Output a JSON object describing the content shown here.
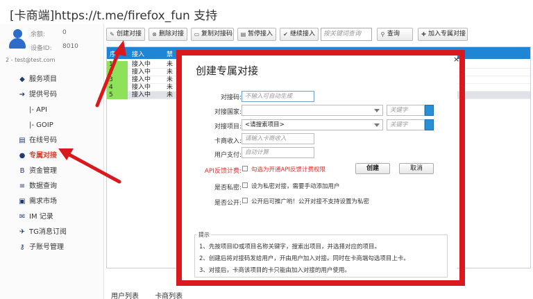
{
  "window": {
    "title": "[卡商端]https://t.me/firefox_fun 支持"
  },
  "account": {
    "balance_label": "余额:",
    "balance_value": "0",
    "id_label": "设备ID:",
    "id_value": "8010",
    "user_line": "2 - test@test.com"
  },
  "sidebar": {
    "items": [
      {
        "label": "服务项目",
        "icon": "diamond-icon",
        "glyph": "◆"
      },
      {
        "label": "提供号码",
        "icon": "arrow-icon",
        "glyph": "➔"
      },
      {
        "label": "|- API",
        "icon": "",
        "glyph": ""
      },
      {
        "label": "|- GOIP",
        "icon": "",
        "glyph": ""
      },
      {
        "label": "在线号码",
        "icon": "list-icon",
        "glyph": "▤"
      },
      {
        "label": "专属对接",
        "icon": "users-icon",
        "glyph": "●"
      },
      {
        "label": "资金管理",
        "icon": "bold-b-icon",
        "glyph": "B"
      },
      {
        "label": "数据查询",
        "icon": "bars-icon",
        "glyph": "≡"
      },
      {
        "label": "需求市场",
        "icon": "doc-icon",
        "glyph": "▣"
      },
      {
        "label": "IM 记录",
        "icon": "mail-icon",
        "glyph": "✉"
      },
      {
        "label": "TG消息订阅",
        "icon": "tg-icon",
        "glyph": "✈"
      },
      {
        "label": "子账号管理",
        "icon": "key-icon",
        "glyph": "⚷"
      }
    ]
  },
  "toolbar": {
    "create": "创建对接",
    "delete": "删除对接",
    "copy": "复制对接码",
    "pause": "暂停接入",
    "resume": "继续接入",
    "search_placeholder": "按关键词查询",
    "query": "查询",
    "join": "加入专属对接"
  },
  "grid": {
    "headers": [
      "序",
      "接入",
      "禁"
    ],
    "rows": [
      {
        "num": "1",
        "status": "接入中",
        "c3": "未"
      },
      {
        "num": "2",
        "status": "接入中",
        "c3": "未"
      },
      {
        "num": "3",
        "status": "接入中",
        "c3": "未"
      },
      {
        "num": "4",
        "status": "接入中",
        "c3": "未"
      },
      {
        "num": "5",
        "status": "接入中",
        "c3": "未"
      }
    ]
  },
  "bottom_tabs": [
    "用户列表",
    "卡商列表"
  ],
  "dialog": {
    "title": "创建专属对接",
    "close": "×",
    "code_label": "对接码:",
    "code_placeholder": "不输入可自动生成",
    "country_label": "对接国家:",
    "keyword_placeholder": "关键字",
    "project_label": "对接项目:",
    "project_value": "<请搜索项目>",
    "income_label": "卡商收入:",
    "income_placeholder": "请输入卡商收入",
    "pay_label": "用户支付:",
    "pay_placeholder": "自动计算",
    "api_label": "API反馈计费:",
    "api_text": "勾选为开通API反馈计费权限",
    "create_btn": "创建",
    "cancel_btn": "取消",
    "private_label": "是否私密:",
    "private_text": "设为私密对接，需要手动添加用户",
    "public_label": "是否公开:",
    "public_text": "公开后可推广哟！公开对接不支持设置为私密",
    "tips_title": "提示",
    "tips": [
      "1、先按项目ID或项目名称关键字，搜索出项目，并选择对应的项目。",
      "2、创建后将对接码发给用户，开由用户加入对接。同时在卡商端勾选项目上卡。",
      "3、对接后，卡商该项目的卡只能由加入对接的用户使用。"
    ]
  },
  "colors": {
    "accent": "#1e86d4",
    "annotation": "#d9191e",
    "active_menu": "#e03a2a",
    "row_num": "#8de25a"
  }
}
